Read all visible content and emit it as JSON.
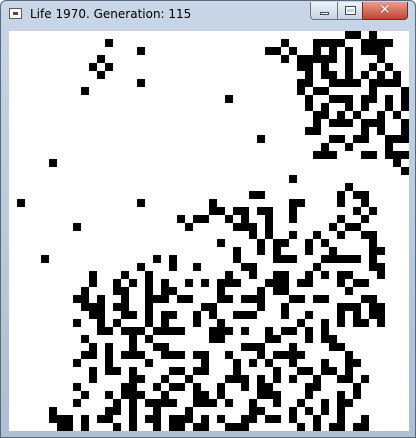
{
  "window": {
    "title": "Life 1970. Generation: 115",
    "icon": "application-icon",
    "controls": {
      "minimize": "minimize-icon",
      "maximize": "maximize-icon",
      "close": "close-icon",
      "close_glyph": "✕"
    }
  },
  "board": {
    "columns": 50,
    "rows": 50,
    "alive_color": "#000000",
    "dead_color": "#ffffff",
    "grid": [
      "..........................................##.#....",
      "............#.....................#...####..####..",
      "................#...............##.#..#.#.#.###...",
      "...........#......................#.#####.#...#...",
      "..........#.#.......................##.#..#..#.#..",
      "...........#.........................#.##.#.#.#.#.",
      "................#...................##..####.####.",
      ".........#..........................#.##.....#...#",
      "...........................#.........#..###.##.#.#",
      ".....................................#.#..#.#..#.#",
      "......................................##.#.#..#.#.",
      "......................................#.###.###..#",
      ".....................................##.....#.#..#",
      "...............................#........##.##..###",
      ".......................................#..#....#..",
      "......................................###...##.###",
      ".....#..........................................#.",
      ".................................................#",
      "...................................#..............",
      "..........................................#.......",
      "..............................##.........#.##.....",
      ".#..............#........#.........##....#..#.....",
      ".........................##.##.##..#.......#.#....",
      ".....................#.##..#.#..#..#.....#..#.....",
      "........#.............#.....###.#.......#.##......",
      "..............................#.#..#..#..#..##....",
      "..........................#....#.##..#.#.....#....",
      "............................#..#.#...#..#....##...",
      "....#.............#.#.......#....###...#####.#....",
      "................#...#..#.....##.......#......##...",
      "..........#...#..#.........#..#..##..#.#.##...#...",
      "..........#..#.#.#.#..#.#.###...###.##...#.##.....",
      ".........#...##..#.##.....#....#.##.......#.......",
      "........##.#..#..###.##...##.###...##.##....##....",
      ".........###.##..#......##.....#..#......###.##...",
      "..........##..##.#.##..#.#..###...#..#...#.#.##...",
      "........#..#.#...#.#...#..#.........#..#.#.##.#...",
      "...........##.###.####...###.#..#.##.#.#..........",
      ".........#.....#.#.......##.....##...#.##.........",
      "..........#.#..#..##.........###...#....##........",
      ".........##.#.###..###.##..#...#.####.....#.......",
      "........#...#....#......#...#.#.#..#...#..##......",
      "..........#.##.#....##.##...#....#..##.##.#.......",
      "..........#....##..#..#....###.#.#.#..#..##.#.....",
      "........#.....##..#.##.#..#..#.##....##....#......",
      ".........#..#.###..#...##.#....###...#...#.#......",
      "........#....#.#.####..###.#..#..#..#..#.##.......",
      ".....#......##.#..#...#.......##...#.#.#.#........",
      ".....###.#.##..#.##.###.#.#..##.##.#..#..#..#.....",
      "......##.#...#.#..#.##.##..###......#.#.##.##....."
    ]
  }
}
